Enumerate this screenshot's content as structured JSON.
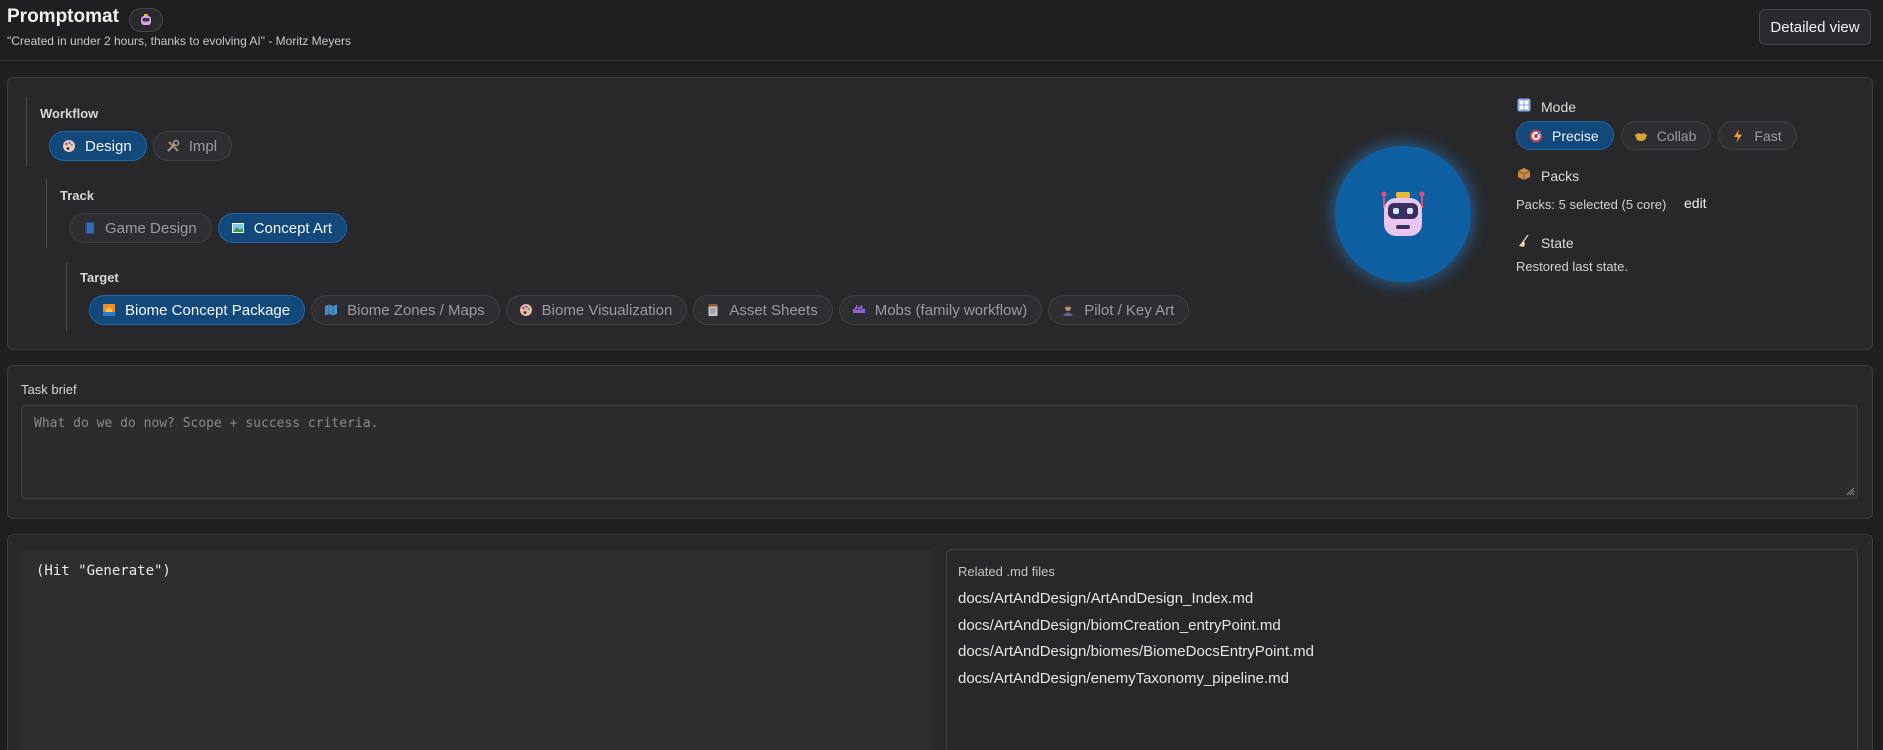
{
  "header": {
    "title": "Promptomat",
    "subtitle": "\"Created in under 2 hours, thanks to evolving AI\" - Moritz Meyers",
    "detailed_view_label": "Detailed view"
  },
  "workflow": {
    "label": "Workflow",
    "options": [
      {
        "label": "Design",
        "icon": "palette-icon",
        "active": true
      },
      {
        "label": "Impl",
        "icon": "tools-icon",
        "active": false
      }
    ]
  },
  "track": {
    "label": "Track",
    "options": [
      {
        "label": "Game Design",
        "icon": "book-icon",
        "active": false
      },
      {
        "label": "Concept Art",
        "icon": "picture-icon",
        "active": true
      }
    ]
  },
  "target": {
    "label": "Target",
    "options": [
      {
        "label": "Biome Concept Package",
        "icon": "sunrise-icon",
        "active": true
      },
      {
        "label": "Biome Zones / Maps",
        "icon": "map-icon",
        "active": false
      },
      {
        "label": "Biome Visualization",
        "icon": "palette-icon",
        "active": false
      },
      {
        "label": "Asset Sheets",
        "icon": "notepad-icon",
        "active": false
      },
      {
        "label": "Mobs (family workflow)",
        "icon": "alien-icon",
        "active": false
      },
      {
        "label": "Pilot / Key Art",
        "icon": "pilot-icon",
        "active": false
      }
    ]
  },
  "mode": {
    "label": "Mode",
    "options": [
      {
        "label": "Precise",
        "icon": "target-icon",
        "active": true
      },
      {
        "label": "Collab",
        "icon": "handshake-icon",
        "active": false
      },
      {
        "label": "Fast",
        "icon": "lightning-icon",
        "active": false
      }
    ]
  },
  "packs": {
    "label": "Packs",
    "summary": "Packs: 5 selected (5 core)",
    "edit_label": "edit"
  },
  "state": {
    "label": "State",
    "text": "Restored last state."
  },
  "task_brief": {
    "label": "Task brief",
    "placeholder": "What do we do now? Scope + success criteria."
  },
  "output": {
    "text": "(Hit \"Generate\")"
  },
  "related_files": {
    "label": "Related .md files",
    "files": [
      "docs/ArtAndDesign/ArtAndDesign_Index.md",
      "docs/ArtAndDesign/biomCreation_entryPoint.md",
      "docs/ArtAndDesign/biomes/BiomeDocsEntryPoint.md",
      "docs/ArtAndDesign/enemyTaxonomy_pipeline.md"
    ]
  },
  "colors": {
    "background": "#1f1f21",
    "panel": "#28282b",
    "accent_active": "#13497a",
    "robot_circle": "#0f5fa3"
  }
}
